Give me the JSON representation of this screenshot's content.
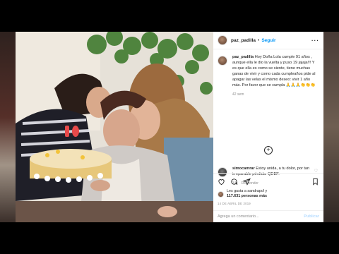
{
  "post": {
    "username": "paz_padilla",
    "follow_label": "Seguir",
    "caption_user": "paz_padilla",
    "caption_text": "Hoy Doña Lola cumple 91 años , aunque ella le dio la vuelta y puso 19 jajaja!!! Y es que ella es como se siente, tiene muchas ganas de vivir y como cada cumpleaños pide al apagar las velas el mismo deseo: vivir 1 año más. Por favor que se cumpla 🙏🙏🙏👏👏👏",
    "caption_time": "42 sem",
    "comment_user": "simocamrar",
    "comment_text": "Estoy unida, a tu dolor, por tan irreparable pérdida. QDEP.",
    "comment_time": "3 h",
    "comment_reply": "Responder",
    "likes_line1": "Les gusta a sandrapcf y",
    "likes_line2": "117.631 personas más",
    "date": "14 DE ABRIL DE 2019",
    "add_comment_placeholder": "Agrega un comentario...",
    "publish_label": "Publicar"
  },
  "colors": {
    "link": "#0095f6",
    "muted": "#8e8e8e"
  },
  "icons": [
    "more-icon",
    "plus-circle-icon",
    "heart-icon",
    "comment-icon",
    "share-icon",
    "bookmark-icon"
  ]
}
